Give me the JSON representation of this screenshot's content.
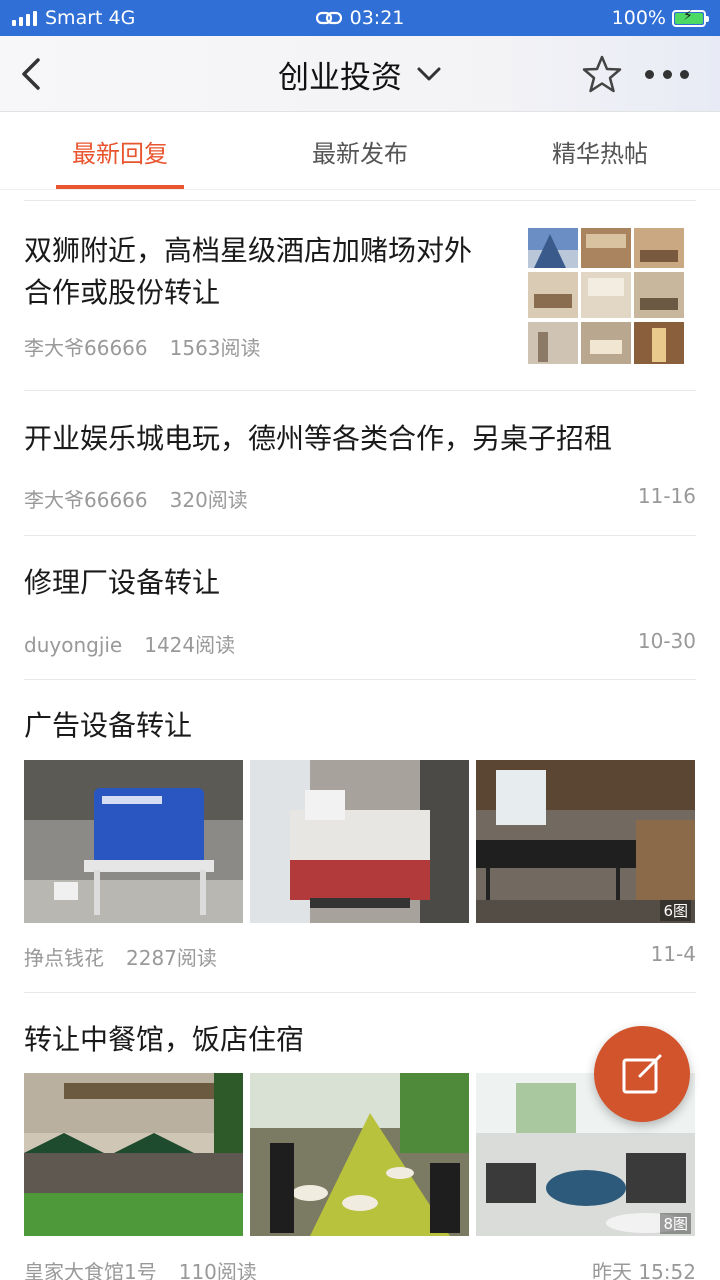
{
  "status_bar": {
    "carrier": "Smart 4G",
    "time": "03:21",
    "battery": "100%"
  },
  "nav": {
    "title": "创业投资"
  },
  "tabs": [
    {
      "label": "最新回复",
      "active": true
    },
    {
      "label": "最新发布",
      "active": false
    },
    {
      "label": "精华热帖",
      "active": false
    }
  ],
  "posts": [
    {
      "title_line1": "双狮附近，高档星级酒店加赌场对外",
      "title_line2": "合作或股份转让",
      "author": "李大爷66666",
      "reads": "1563阅读",
      "date": ""
    },
    {
      "title_line1": "开业娱乐城电玩，德州等各类合作，另桌子招租",
      "author": "李大爷66666",
      "reads": "320阅读",
      "date": "11-16"
    },
    {
      "title_line1": "修理厂设备转让",
      "author": "duyongjie",
      "reads": "1424阅读",
      "date": "10-30"
    },
    {
      "title_line1": "广告设备转让",
      "author": "挣点钱花",
      "reads": "2287阅读",
      "date": "11-4",
      "image_count": "6图"
    },
    {
      "title_line1": "转让中餐馆，饭店住宿",
      "author": "皇家大食馆1号",
      "reads": "110阅读",
      "date": "昨天 15:52",
      "image_count": "8图"
    }
  ],
  "colors": {
    "accent": "#e8552e",
    "status_bar": "#2f6fd6",
    "fab": "#d2542d"
  }
}
